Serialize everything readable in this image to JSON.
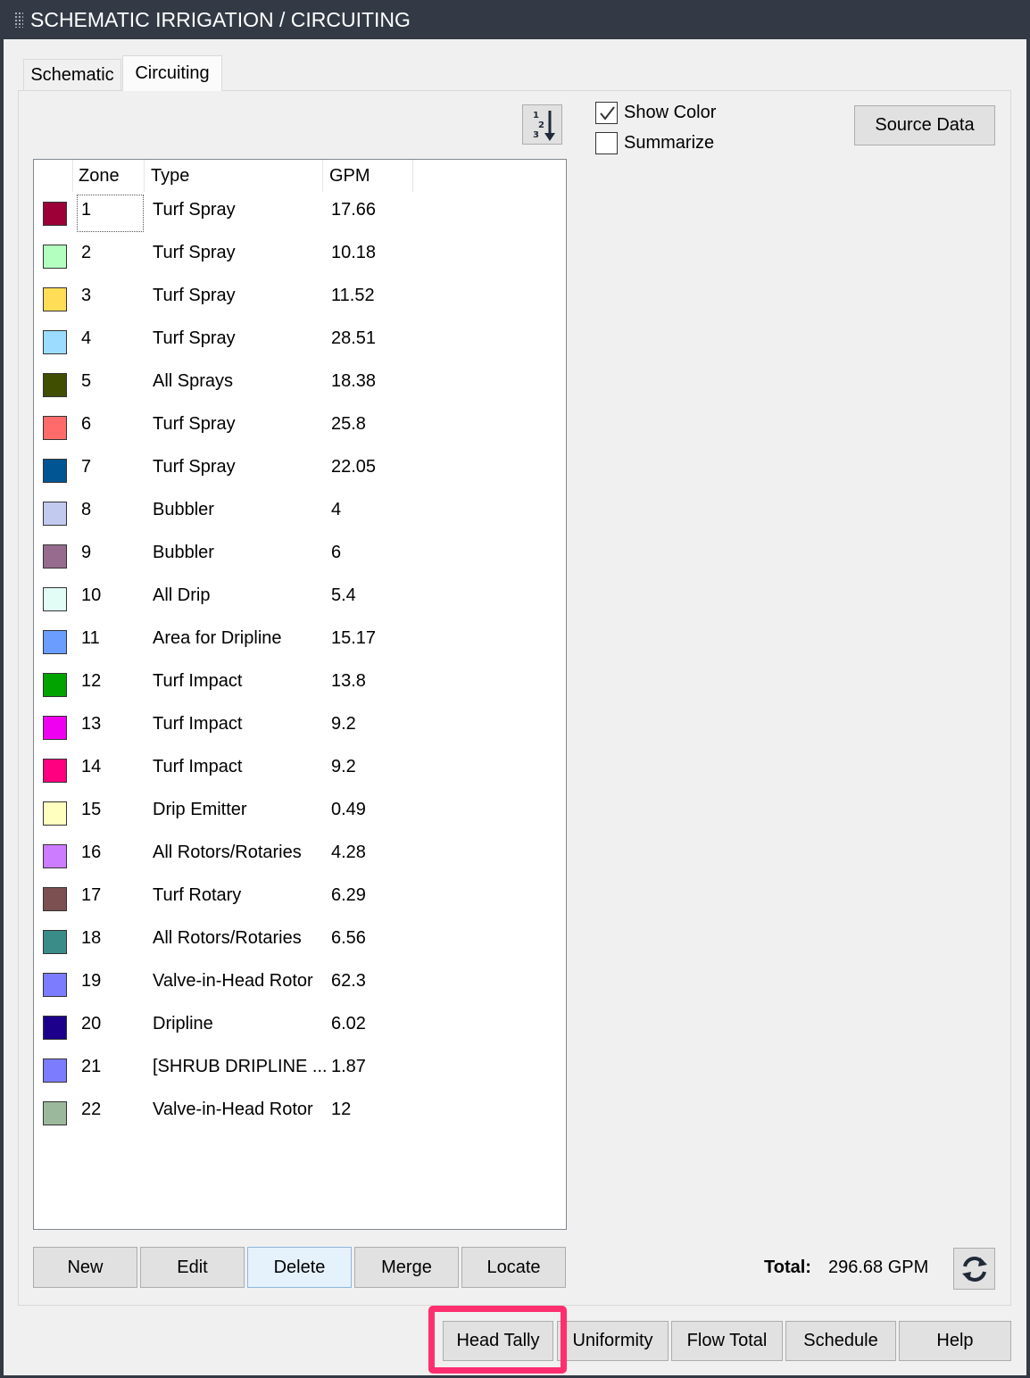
{
  "window": {
    "title": "SCHEMATIC IRRIGATION / CIRCUITING"
  },
  "tabs": [
    {
      "label": "Schematic",
      "active": false
    },
    {
      "label": "Circuiting",
      "active": true
    }
  ],
  "options": {
    "show_color": {
      "label": "Show Color",
      "checked": true
    },
    "summarize": {
      "label": "Summarize",
      "checked": false
    }
  },
  "toolbar": {
    "source_data_label": "Source Data",
    "sort_icon": "sort-numeric-ascending-icon"
  },
  "table": {
    "columns": {
      "zone": "Zone",
      "type": "Type",
      "gpm": "GPM"
    },
    "rows": [
      {
        "color": "#9c0037",
        "zone": "1",
        "type": "Turf Spray",
        "gpm": "17.66"
      },
      {
        "color": "#b3ffc0",
        "zone": "2",
        "type": "Turf Spray",
        "gpm": "10.18"
      },
      {
        "color": "#ffdd57",
        "zone": "3",
        "type": "Turf Spray",
        "gpm": "11.52"
      },
      {
        "color": "#9cdcff",
        "zone": "4",
        "type": "Turf Spray",
        "gpm": "28.51"
      },
      {
        "color": "#3f4e00",
        "zone": "5",
        "type": "All Sprays",
        "gpm": "18.38"
      },
      {
        "color": "#ff6b6b",
        "zone": "6",
        "type": "Turf Spray",
        "gpm": "25.8"
      },
      {
        "color": "#005592",
        "zone": "7",
        "type": "Turf Spray",
        "gpm": "22.05"
      },
      {
        "color": "#c3caf0",
        "zone": "8",
        "type": "Bubbler",
        "gpm": "4"
      },
      {
        "color": "#966b8e",
        "zone": "9",
        "type": "Bubbler",
        "gpm": "6"
      },
      {
        "color": "#e2fcf6",
        "zone": "10",
        "type": "All Drip",
        "gpm": "5.4"
      },
      {
        "color": "#6b9cff",
        "zone": "11",
        "type": "Area for Dripline",
        "gpm": "15.17"
      },
      {
        "color": "#00a300",
        "zone": "12",
        "type": "Turf Impact",
        "gpm": "13.8"
      },
      {
        "color": "#f000f0",
        "zone": "13",
        "type": "Turf Impact",
        "gpm": "9.2"
      },
      {
        "color": "#ff0080",
        "zone": "14",
        "type": "Turf Impact",
        "gpm": "9.2"
      },
      {
        "color": "#ffffc0",
        "zone": "15",
        "type": "Drip Emitter",
        "gpm": "0.49"
      },
      {
        "color": "#cc7cff",
        "zone": "16",
        "type": "All Rotors/Rotaries",
        "gpm": "4.28"
      },
      {
        "color": "#7c5050",
        "zone": "17",
        "type": "Turf Rotary",
        "gpm": "6.29"
      },
      {
        "color": "#3a8c88",
        "zone": "18",
        "type": "All Rotors/Rotaries",
        "gpm": "6.56"
      },
      {
        "color": "#7c7cff",
        "zone": "19",
        "type": "Valve-in-Head Rotor",
        "gpm": "62.3"
      },
      {
        "color": "#1c008c",
        "zone": "20",
        "type": "Dripline",
        "gpm": "6.02"
      },
      {
        "color": "#7c7cff",
        "zone": "21",
        "type": "[SHRUB DRIPLINE ...",
        "gpm": "1.87"
      },
      {
        "color": "#9cb89c",
        "zone": "22",
        "type": "Valve-in-Head Rotor",
        "gpm": "12"
      }
    ]
  },
  "list_buttons": {
    "new": "New",
    "edit": "Edit",
    "delete": "Delete",
    "merge": "Merge",
    "locate": "Locate"
  },
  "total": {
    "label": "Total:",
    "value": "296.68 GPM",
    "refresh_icon": "refresh-icon"
  },
  "bottom_buttons": {
    "head_tally": "Head Tally",
    "uniformity": "Uniformity",
    "flow_total": "Flow Total",
    "schedule": "Schedule",
    "help": "Help"
  },
  "colors": {
    "titlebar": "#333a45",
    "highlight": "#ff2e6e"
  }
}
